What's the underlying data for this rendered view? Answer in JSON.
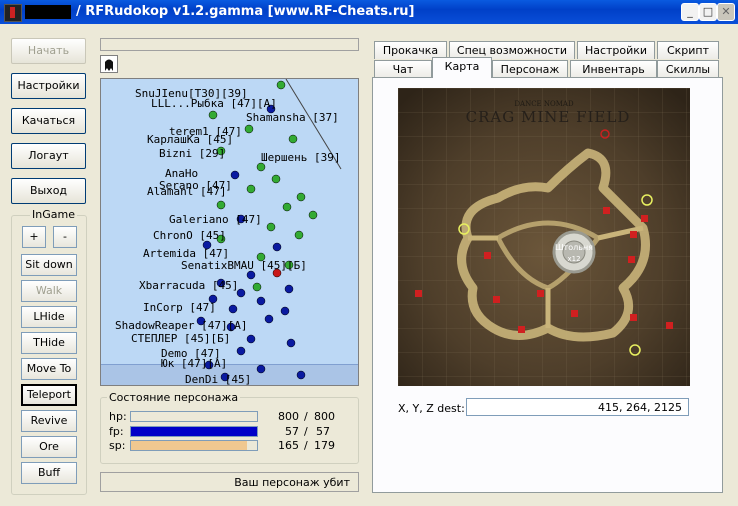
{
  "window": {
    "title": "/ RFRudokop v1.2.gamma [www.RF-Cheats.ru]",
    "minimize_glyph": "_",
    "maximize_glyph": "□",
    "close_glyph": "✕"
  },
  "left_buttons": [
    "Начать",
    "Настройки",
    "Качаться",
    "Логаут",
    "Выход"
  ],
  "ingame": {
    "label": "InGame",
    "plus": "+",
    "minus": "-",
    "buttons": [
      "Sit down",
      "Walk",
      "LHide",
      "THide",
      "Move To",
      "Teleport",
      "Revive",
      "Ore",
      "Buff"
    ]
  },
  "radar": {
    "names": [
      {
        "text": "SnuJIenu[T30][39]",
        "color": "#000"
      },
      {
        "text": "LLL...Рыбка [47][A]",
        "color": "#000"
      },
      {
        "text": "Shamansha [37]",
        "color": "#000"
      },
      {
        "text": "terem1 [47]",
        "color": "#000"
      },
      {
        "text": "КарлашКа [45]",
        "color": "#000"
      },
      {
        "text": "Bizni [29]",
        "color": "#000"
      },
      {
        "text": "Шершень [39]",
        "color": "#000"
      },
      {
        "text": "AnaHo",
        "color": "#000"
      },
      {
        "text": "Serano [47]",
        "color": "#000"
      },
      {
        "text": "Alamanl [47]",
        "color": "#000"
      },
      {
        "text": "Galeriano [47]",
        "color": "#000"
      },
      {
        "text": "ChronO [45]",
        "color": "#000"
      },
      {
        "text": "Artemida [47]",
        "color": "#000"
      },
      {
        "text": "SenatixBMAU [45][Б]",
        "color": "#000"
      },
      {
        "text": "Xbarracuda [45]",
        "color": "#000"
      },
      {
        "text": "InCorp [47]",
        "color": "#000"
      },
      {
        "text": "ShadowReaper [47][A]",
        "color": "#000"
      },
      {
        "text": "СТЕПЛЕР [45][Б]",
        "color": "#000"
      },
      {
        "text": "Demo [47]",
        "color": "#000"
      },
      {
        "text": "Юк [47][A]",
        "color": "#000"
      },
      {
        "text": "DenDi [45]",
        "color": "#000"
      }
    ]
  },
  "stats": {
    "label": "Состояние персонажа",
    "rows": [
      {
        "name": "hp:",
        "cur": "800",
        "sep": "/",
        "max": "800",
        "frac": 1.0,
        "color": "#ece9d8"
      },
      {
        "name": "fp:",
        "cur": "57",
        "sep": "/",
        "max": "57",
        "frac": 1.0,
        "color": "#0000c8"
      },
      {
        "name": "sp:",
        "cur": "165",
        "sep": "/",
        "max": "179",
        "frac": 0.92,
        "color": "#f0c890"
      }
    ]
  },
  "status": "Ваш персонаж убит",
  "tabs_row1": [
    "Прокачка",
    "Спец возможности",
    "Настройки",
    "Скрипт"
  ],
  "tabs_row2": [
    "Чат",
    "Карта",
    "Персонаж",
    "Инвентарь",
    "Скиллы"
  ],
  "active_tab": "Карта",
  "map": {
    "region_top": "DANCE NOMAD",
    "title": "CRAG MINE FIELD",
    "center_label": "Штольня",
    "center_sub": "x12"
  },
  "coords": {
    "label": "X, Y, Z dest:",
    "value": "415, 264, 2125"
  },
  "colors": {
    "titlebar": "#0a4fd8",
    "player_green": "#33aa33",
    "player_blue": "#0a1aa0",
    "player_red": "#c81818"
  }
}
